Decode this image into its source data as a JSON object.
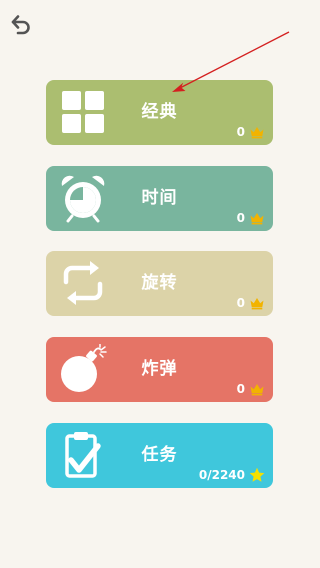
{
  "colors": {
    "background": "#f8f5ef",
    "icon_ink": "#545454",
    "arrow": "#d42020",
    "crown": "#f2b300",
    "star": "#f5e100"
  },
  "nav": {
    "back_icon": "back-arrow-icon"
  },
  "modes": [
    {
      "id": "classic",
      "label": "经典",
      "score": "0",
      "score_icon": "crown-icon",
      "icon": "grid-icon",
      "color": "#abbe70"
    },
    {
      "id": "time",
      "label": "时间",
      "score": "0",
      "score_icon": "crown-icon",
      "icon": "alarm-clock-icon",
      "color": "#79b59e"
    },
    {
      "id": "rotate",
      "label": "旋转",
      "score": "0",
      "score_icon": "crown-icon",
      "icon": "rotate-icon",
      "color": "#dcd3a8"
    },
    {
      "id": "bomb",
      "label": "炸弹",
      "score": "0",
      "score_icon": "crown-icon",
      "icon": "bomb-icon",
      "color": "#e57466"
    },
    {
      "id": "tasks",
      "label": "任务",
      "score": "0/2240",
      "score_icon": "star-icon",
      "icon": "clipboard-icon",
      "color": "#3fc7dc"
    }
  ]
}
